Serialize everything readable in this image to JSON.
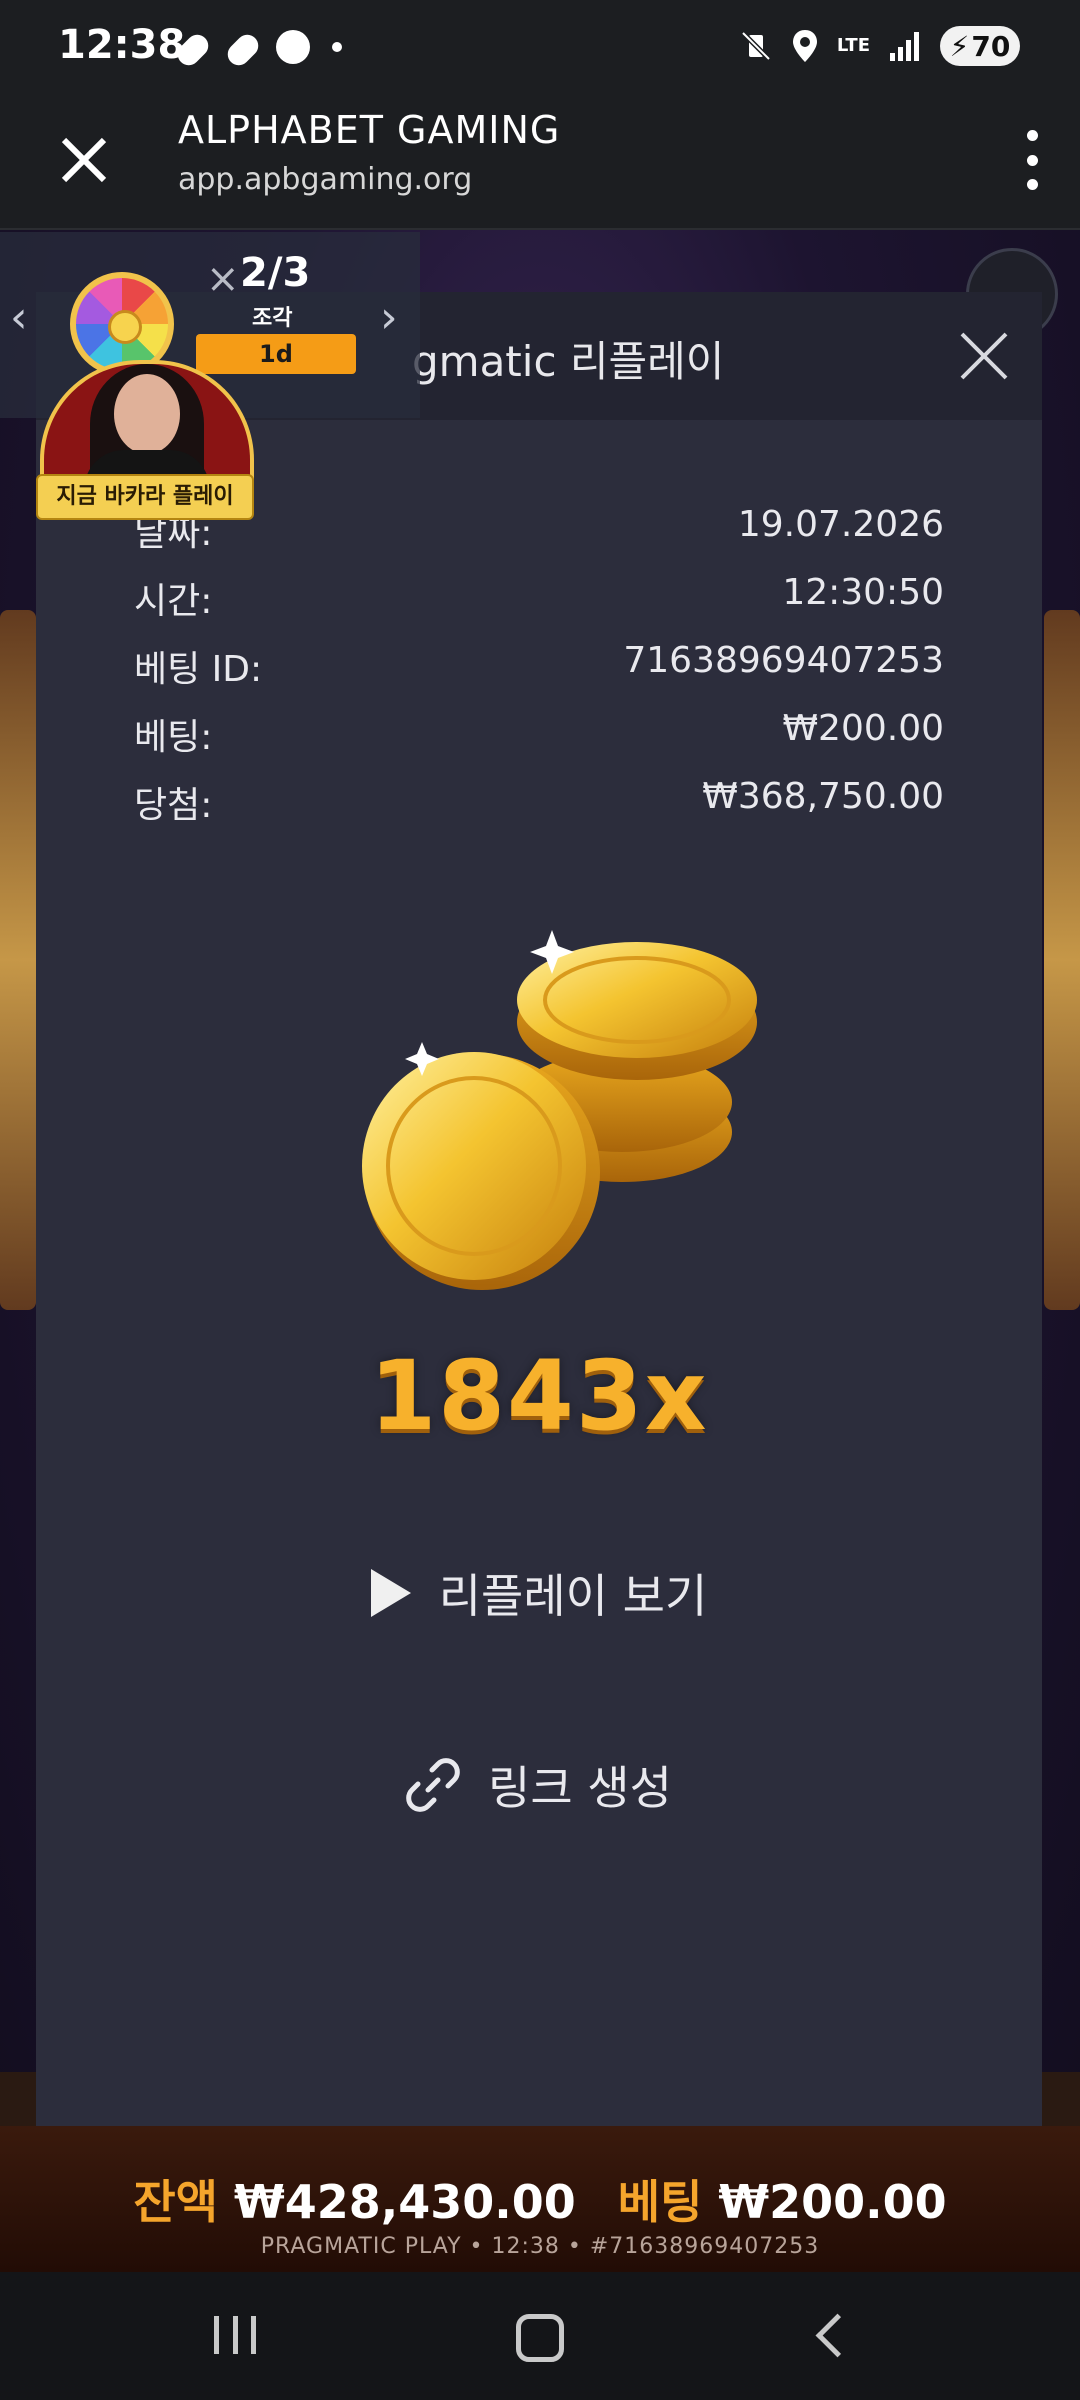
{
  "status_bar": {
    "time": "12:38",
    "network": "LTE",
    "battery": "70"
  },
  "app_bar": {
    "title": "ALPHABET GAMING",
    "url": "app.apbgaming.org"
  },
  "modal": {
    "title": "gmatic 리플레이",
    "rows": [
      {
        "label": "날짜:",
        "value": "19.07.2026"
      },
      {
        "label": "시간:",
        "value": "12:30:50"
      },
      {
        "label": "베팅 ID:",
        "value": "71638969407253"
      },
      {
        "label": "베팅:",
        "value": "₩200.00"
      },
      {
        "label": "당첨:",
        "value": "₩368,750.00"
      }
    ],
    "multiplier": "1843x",
    "replay_label": "리플레이 보기",
    "link_label": "링크 생성"
  },
  "widget": {
    "count": "2/3",
    "label": "조각",
    "timer": "1d"
  },
  "promo": {
    "badge": "지금 바카라 플레이"
  },
  "bottom": {
    "balance_label": "잔액",
    "balance_value": "₩428,430.00",
    "bet_label": "베팅",
    "bet_value": "₩200.00",
    "meta": "PRAGMATIC PLAY • 12:38 • #71638969407253"
  }
}
